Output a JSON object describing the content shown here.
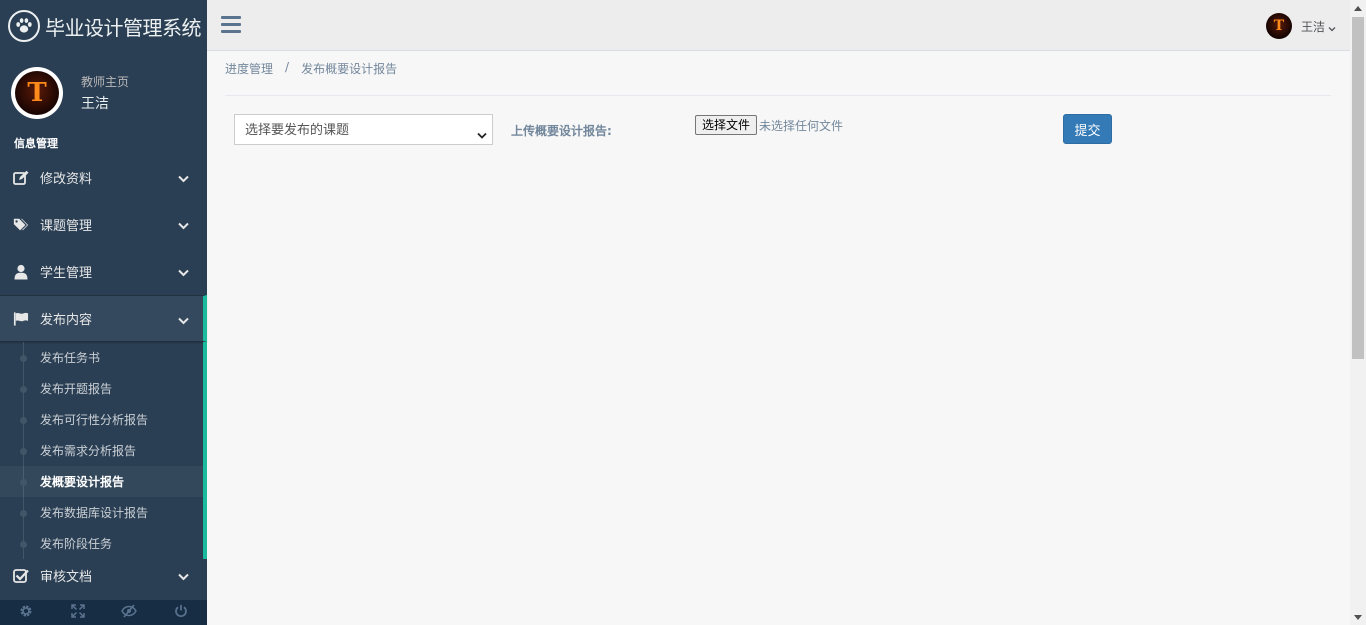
{
  "app": {
    "title": "毕业设计管理系统"
  },
  "profile": {
    "role": "教师主页",
    "name": "王洁",
    "avatar_letter": "T"
  },
  "sidebar": {
    "section_title": "信息管理",
    "items": [
      {
        "label": "修改资料",
        "icon": "edit-icon"
      },
      {
        "label": "课题管理",
        "icon": "tags-icon"
      },
      {
        "label": "学生管理",
        "icon": "user-icon"
      },
      {
        "label": "发布内容",
        "icon": "flag-icon"
      }
    ],
    "submenu": [
      "发布任务书",
      "发布开题报告",
      "发布可行性分析报告",
      "发布需求分析报告",
      "发概要设计报告",
      "发布数据库设计报告",
      "发布阶段任务"
    ],
    "review": {
      "label": "审核文档",
      "icon": "checkbox-icon"
    },
    "footer_icons": [
      "settings-icon",
      "fullscreen-icon",
      "eye-slash-icon",
      "power-icon"
    ]
  },
  "topnav": {
    "user_name": "王洁"
  },
  "breadcrumb": [
    "进度管理",
    "发布概要设计报告"
  ],
  "breadcrumb_separator": "/",
  "form": {
    "select_placeholder": "选择要发布的课题",
    "upload_label": "上传概要设计报告:",
    "file_button": "选择文件",
    "file_status": "未选择任何文件",
    "submit_label": "提交"
  },
  "colors": {
    "sidebar": "#2a3f54",
    "accent": "#1abb9c",
    "primary": "#337ab7"
  }
}
